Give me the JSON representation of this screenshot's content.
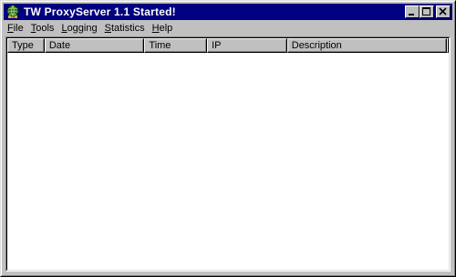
{
  "window": {
    "title": "TW ProxyServer 1.1 Started!",
    "icon": "globe-app-icon",
    "controls": [
      "minimize-icon",
      "maximize-icon",
      "close-icon"
    ]
  },
  "menu": {
    "items": [
      {
        "label_u": "F",
        "label_rest": "ile"
      },
      {
        "label_u": "T",
        "label_rest": "ools"
      },
      {
        "label_u": "L",
        "label_rest": "ogging"
      },
      {
        "label_u": "S",
        "label_rest": "tatistics"
      },
      {
        "label_u": "H",
        "label_rest": "elp"
      }
    ]
  },
  "table": {
    "columns": [
      "Type",
      "Date",
      "Time",
      "IP",
      "Description"
    ],
    "rows": []
  },
  "colors": {
    "titlebar": "#000080",
    "face": "#c0c0c0",
    "list_background": "#ffffff"
  }
}
